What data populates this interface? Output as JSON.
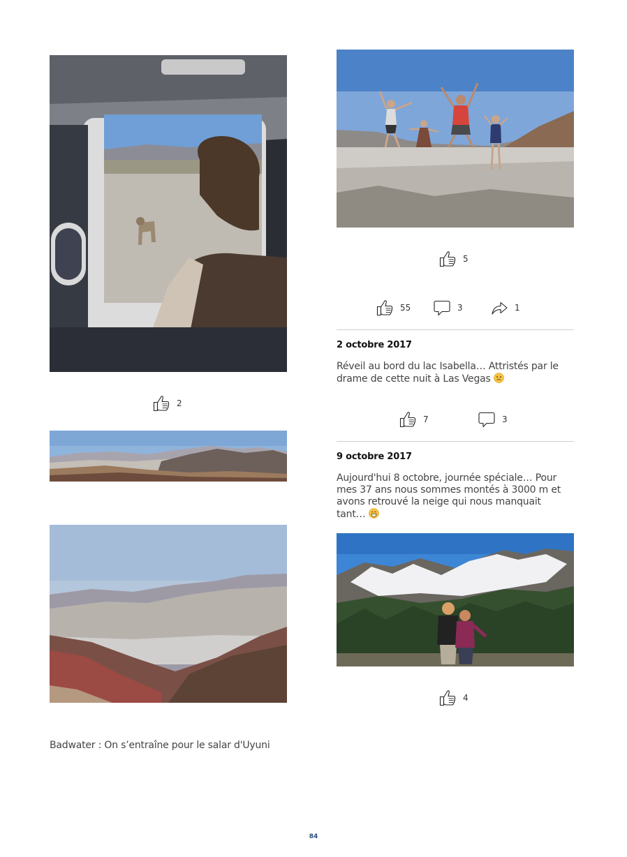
{
  "left": {
    "photo1_likes": "2",
    "caption": "Badwater : On s’entraîne pour le salar d'Uyuni"
  },
  "right": {
    "photo_likes": "5",
    "post1": {
      "likes": "55",
      "comments": "3",
      "shares": "1"
    },
    "post2": {
      "date": "2 octobre 2017",
      "text": "Réveil au bord du lac Isabella… Attristés par le drame de cette nuit à Las Vegas",
      "likes": "7",
      "comments": "3"
    },
    "post3": {
      "date": "9 octobre 2017",
      "text": "Aujourd'hui 8 octobre, journée spéciale… Pour mes 37 ans nous sommes montés à 3000 m et avons retrouvé la neige qui nous manquait tant…",
      "photo_likes": "4"
    }
  },
  "page_number": "84",
  "icons": [
    "like-icon",
    "comment-icon",
    "share-icon",
    "sad-emoji-icon",
    "smile-emoji-icon"
  ]
}
